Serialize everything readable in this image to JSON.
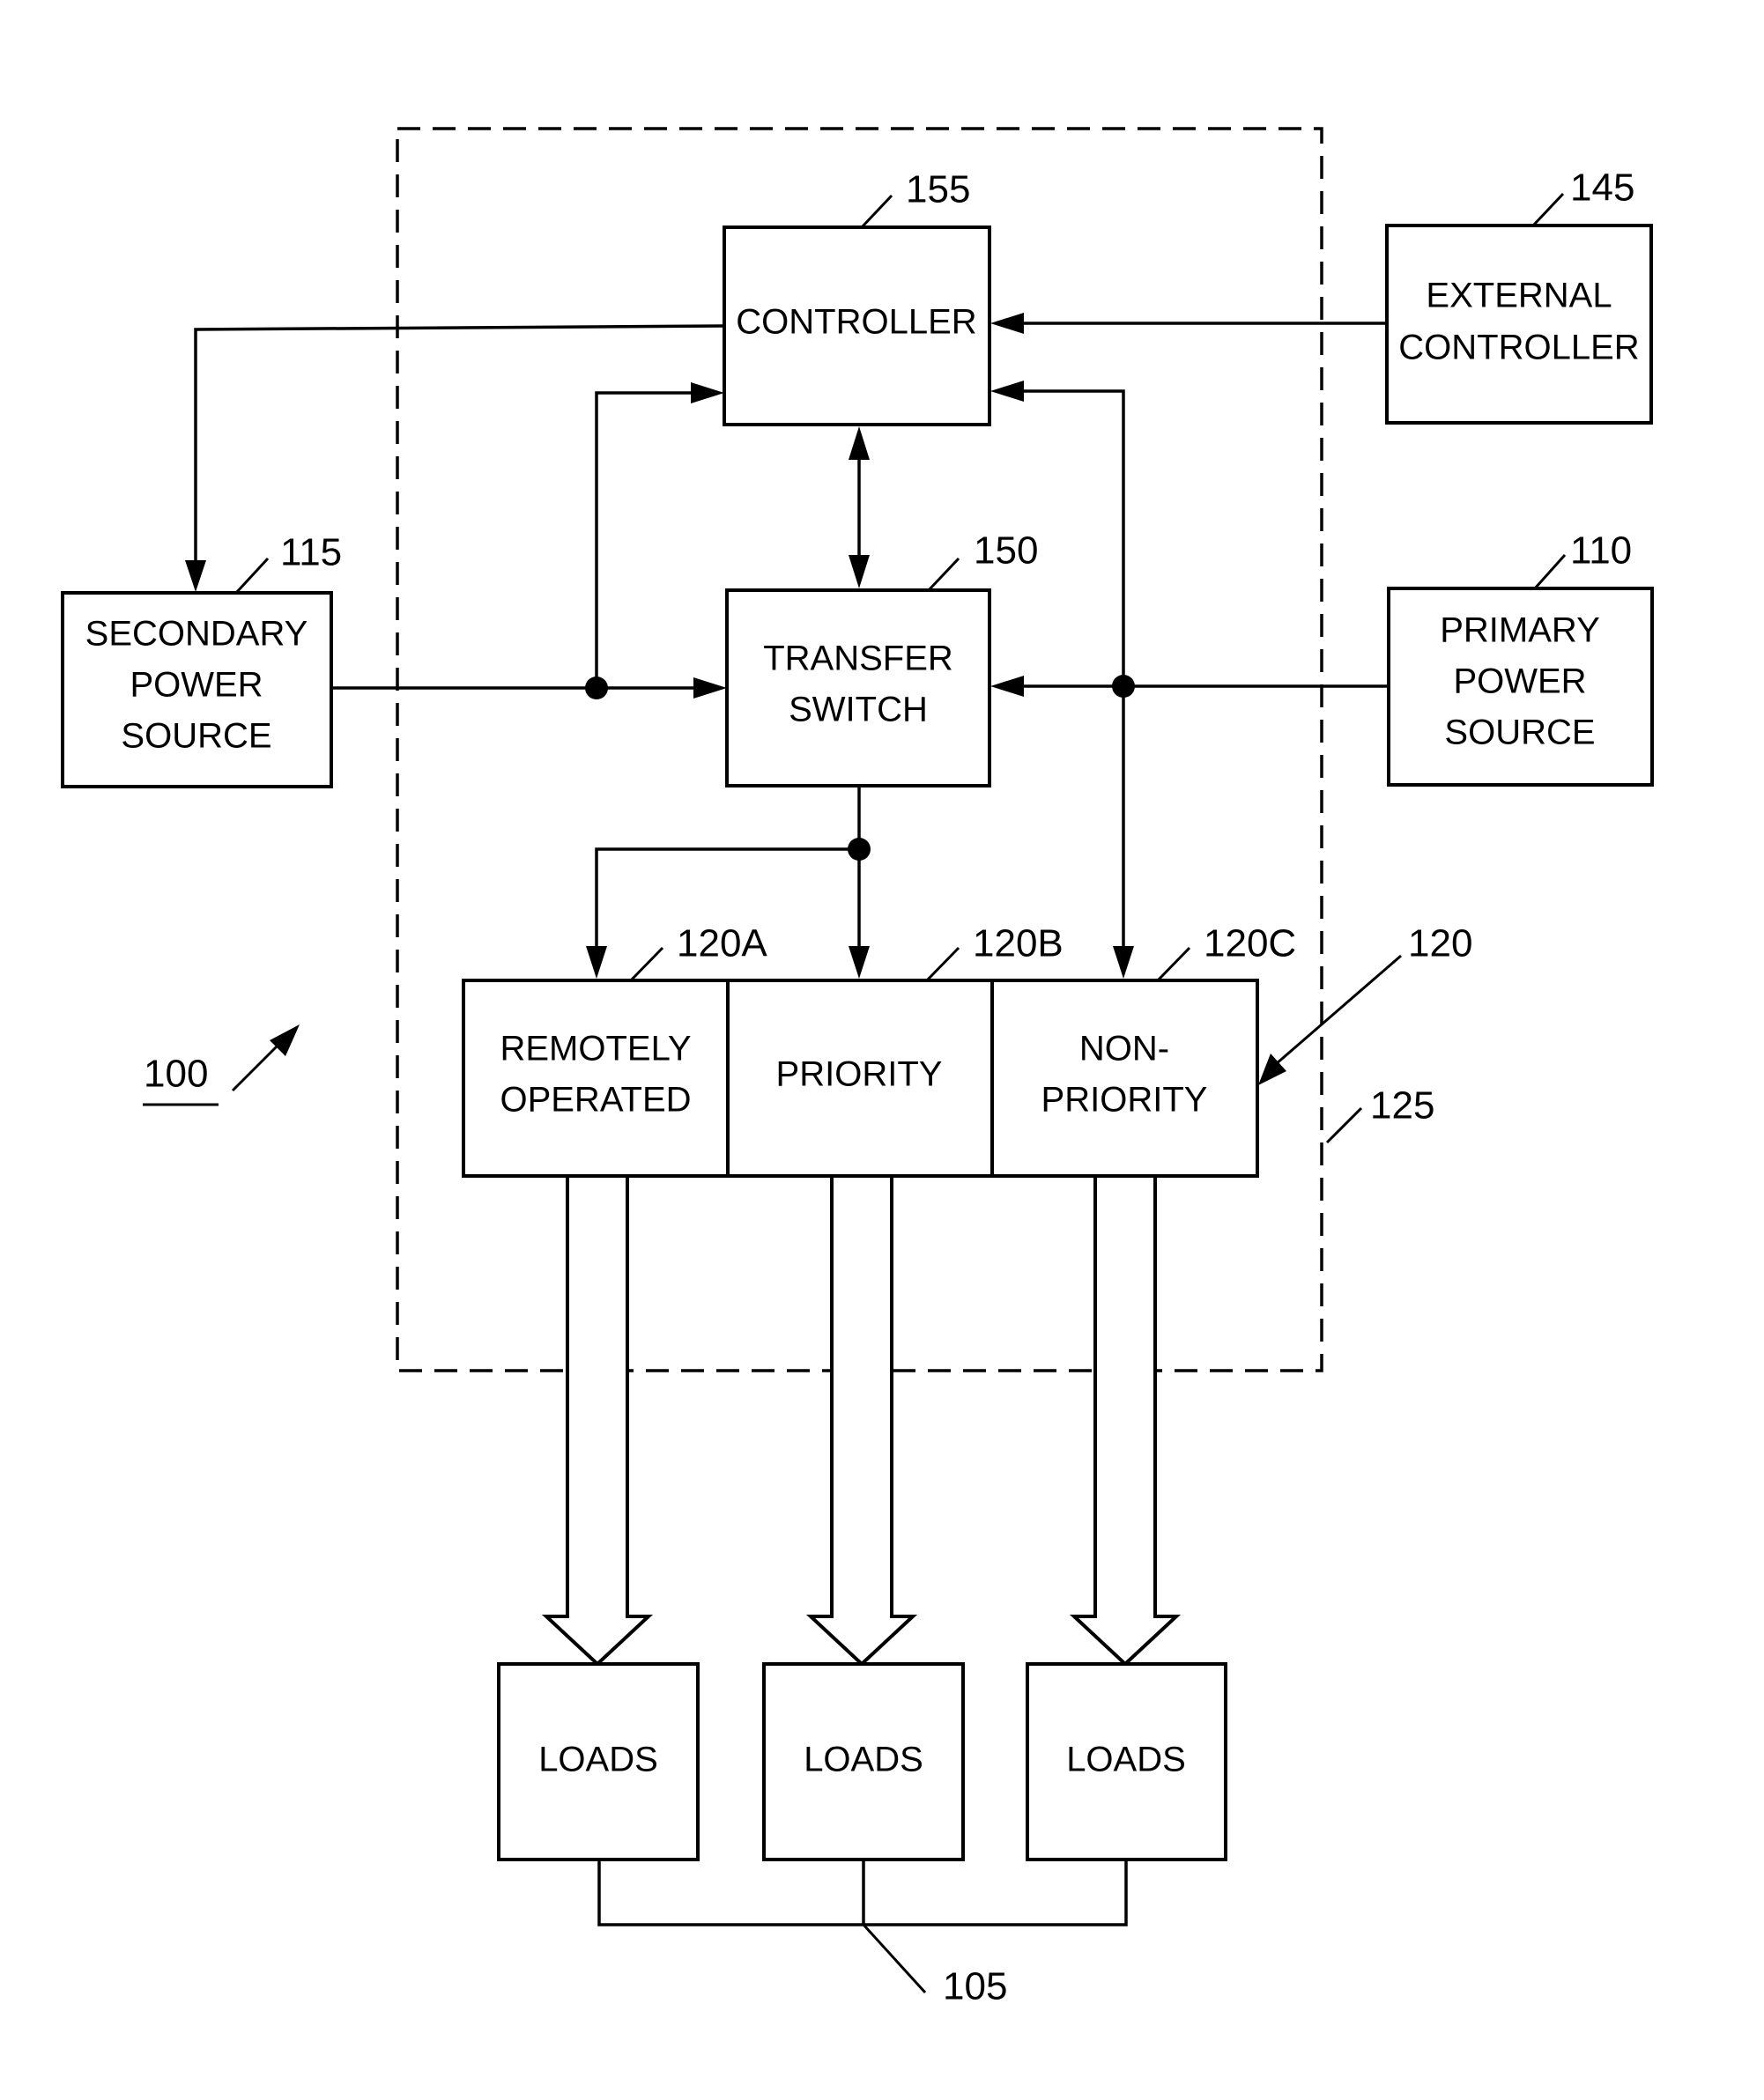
{
  "figure": {
    "reference": "100",
    "enclosure_reference": "125",
    "panel_group_reference": "120",
    "loads_group_reference": "105"
  },
  "blocks": {
    "controller": {
      "ref": "155",
      "lines": [
        "CONTROLLER"
      ]
    },
    "external_controller": {
      "ref": "145",
      "lines": [
        "EXTERNAL",
        "CONTROLLER"
      ]
    },
    "transfer_switch": {
      "ref": "150",
      "lines": [
        "TRANSFER",
        "SWITCH"
      ]
    },
    "secondary_power": {
      "ref": "115",
      "lines": [
        "SECONDARY",
        "POWER",
        "SOURCE"
      ]
    },
    "primary_power": {
      "ref": "110",
      "lines": [
        "PRIMARY",
        "POWER",
        "SOURCE"
      ]
    },
    "panel_remote": {
      "ref": "120A",
      "lines": [
        "REMOTELY",
        "OPERATED"
      ]
    },
    "panel_priority": {
      "ref": "120B",
      "lines": [
        "PRIORITY"
      ]
    },
    "panel_nonpriority": {
      "ref": "120C",
      "lines": [
        "NON-",
        "PRIORITY"
      ]
    },
    "loads": [
      {
        "lines": [
          "LOADS"
        ]
      },
      {
        "lines": [
          "LOADS"
        ]
      },
      {
        "lines": [
          "LOADS"
        ]
      }
    ]
  }
}
